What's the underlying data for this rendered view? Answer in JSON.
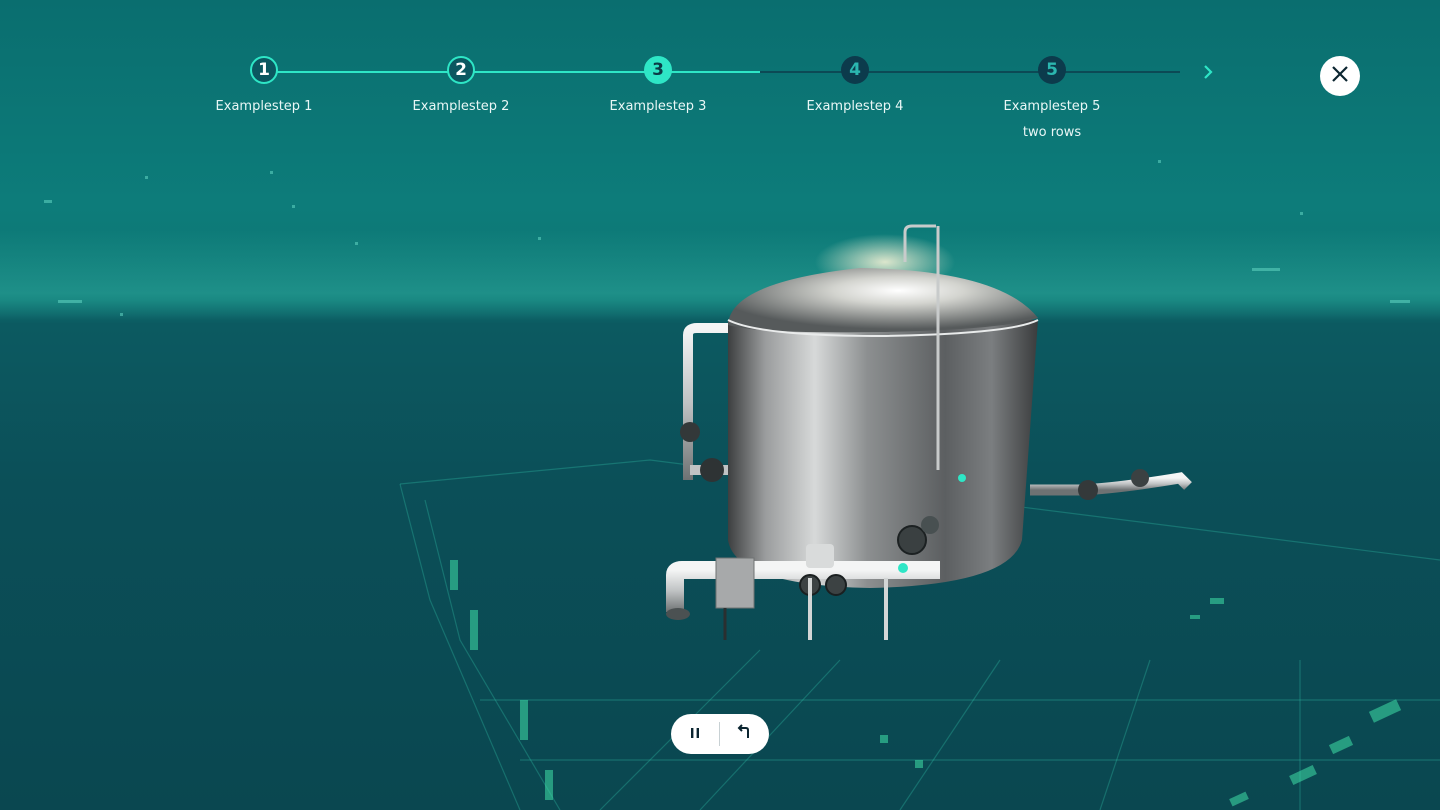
{
  "stepper": {
    "steps": [
      {
        "number": "1",
        "label": "Examplestep 1",
        "state": "done"
      },
      {
        "number": "2",
        "label": "Examplestep 2",
        "state": "done"
      },
      {
        "number": "3",
        "label": "Examplestep 3",
        "state": "active"
      },
      {
        "number": "4",
        "label": "Examplestep 4",
        "state": "todo"
      },
      {
        "number": "5",
        "label": "Examplestep 5",
        "label_line2": "two rows",
        "state": "todo"
      }
    ],
    "next_icon": "chevron-right-icon"
  },
  "close": {
    "icon": "close-icon"
  },
  "controls": {
    "pause_icon": "pause-icon",
    "back_icon": "return-arrow-icon"
  },
  "colors": {
    "accent": "#2ee6c6",
    "background_top": "#0a6e6f",
    "background_bottom": "#0a4750",
    "step_todo": "#0c3b4c"
  }
}
